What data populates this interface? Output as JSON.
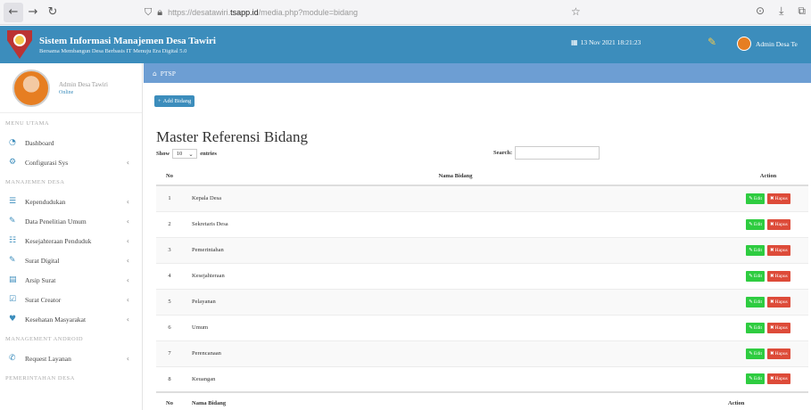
{
  "browser": {
    "url_prefix": "https://desatawiri.",
    "url_domain": "tsapp.id",
    "url_path": "/media.php?module=bidang",
    "icons": {
      "back": "arrow-left-icon",
      "forward": "arrow-right-icon",
      "reload": "reload-icon",
      "security": "shield-icon",
      "lock": "lock-icon",
      "bookmark": "star-icon"
    }
  },
  "header": {
    "title": "Sistem Informasi Manajemen Desa Tawiri",
    "subtitle": "Bersama Membangun Desa Berbasis IT Menuju Era Digital 5.0",
    "datetime": "13 Nov 2021 18:21:23",
    "user_name": "Admin Desa Te",
    "brand_color": "#3c8dbc"
  },
  "sidebar": {
    "user_name": "Admin Desa Tawiri",
    "user_role": "Online",
    "sections": [
      {
        "label": "MENU UTAMA",
        "items": [
          {
            "label": "Dashboard",
            "icon": "dashboard-icon",
            "glyph": "◔",
            "chevron": false
          },
          {
            "label": "Configurasi Sys",
            "icon": "gear-icon",
            "glyph": "⚙",
            "chevron": true
          }
        ]
      },
      {
        "label": "MANAJEMEN DESA",
        "items": [
          {
            "label": "Kependudukan",
            "icon": "table-icon",
            "glyph": "☰",
            "chevron": true
          },
          {
            "label": "Data Penelitian Umum",
            "icon": "edit-icon",
            "glyph": "✎",
            "chevron": true
          },
          {
            "label": "Kesejahteraan Penduduk",
            "icon": "table-icon",
            "glyph": "☷",
            "chevron": true
          },
          {
            "label": "Surat Digital",
            "icon": "edit-icon",
            "glyph": "✎",
            "chevron": true
          },
          {
            "label": "Arsip Surat",
            "icon": "archive-icon",
            "glyph": "▤",
            "chevron": true
          },
          {
            "label": "Surat Creator",
            "icon": "check-icon",
            "glyph": "☑",
            "chevron": true
          },
          {
            "label": "Kesehatan Masyarakat",
            "icon": "heart-icon",
            "glyph": "♥",
            "chevron": true
          }
        ]
      },
      {
        "label": "MANAGEMENT ANDROID",
        "items": [
          {
            "label": "Request Layanan",
            "icon": "phone-icon",
            "glyph": "✆",
            "chevron": true
          }
        ]
      },
      {
        "label": "PEMERINTAHAN DESA",
        "items": []
      }
    ]
  },
  "main": {
    "breadcrumb": "PTSP",
    "add_button": "Add Bidang",
    "page_title": "Master Referensi Bidang",
    "show_label": "Show",
    "show_value": "10",
    "entries_label": "entries",
    "search_label": "Search:",
    "search_value": "",
    "columns": {
      "no": "No",
      "name": "Nama Bidang",
      "action": "Action"
    },
    "edit_label": "Edit",
    "delete_label": "Hapus",
    "rows": [
      {
        "no": "1",
        "name": "Kepala Desa"
      },
      {
        "no": "2",
        "name": "Sekretaris Desa"
      },
      {
        "no": "3",
        "name": "Pemerintahan"
      },
      {
        "no": "4",
        "name": "Kesejahteraan"
      },
      {
        "no": "5",
        "name": "Pelayanan"
      },
      {
        "no": "6",
        "name": "Umum"
      },
      {
        "no": "7",
        "name": "Perencanaan"
      },
      {
        "no": "8",
        "name": "Keuangan"
      }
    ]
  }
}
